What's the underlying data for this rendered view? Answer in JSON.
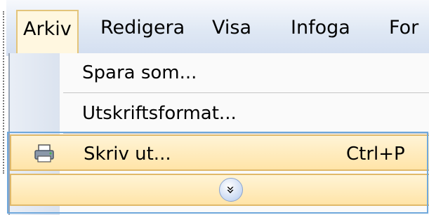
{
  "menubar": {
    "items": [
      {
        "label": "Arkiv"
      },
      {
        "label": "Redigera"
      },
      {
        "label": "Visa"
      },
      {
        "label": "Infoga"
      },
      {
        "label": "For"
      }
    ]
  },
  "dropdown": {
    "items": [
      {
        "label": "Spara som..."
      },
      {
        "label": "Utskriftsformat..."
      },
      {
        "label": "Skriv ut...",
        "shortcut": "Ctrl+P"
      }
    ],
    "expand_glyph": "»"
  },
  "colors": {
    "highlight": "#ffe4a8",
    "highlight_border": "#e0b96a",
    "menubar": "#dfe8f4",
    "focus_ring": "#6fa8dc"
  }
}
